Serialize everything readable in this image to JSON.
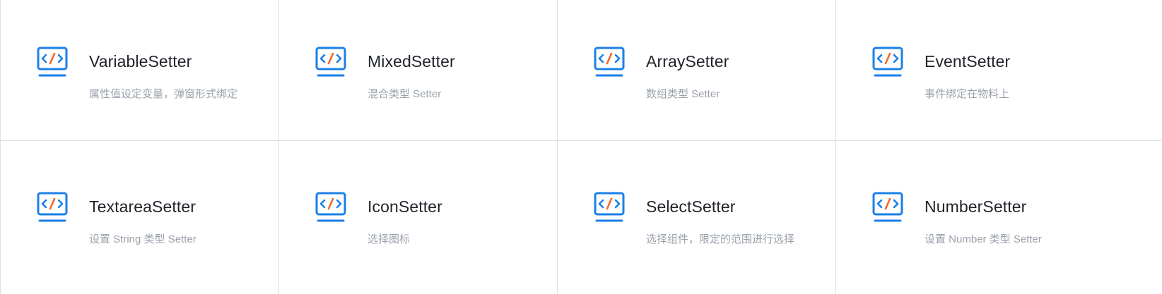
{
  "colors": {
    "icon_blue": "#1b7fe8",
    "icon_orange": "#f26a2b",
    "title": "#1f2329",
    "description": "#9aa1ab",
    "divider": "#dcdfe6"
  },
  "cards": [
    {
      "icon": "code-monitor-icon",
      "title": "VariableSetter",
      "description": "属性值设定变量，弹窗形式绑定"
    },
    {
      "icon": "code-monitor-icon",
      "title": "MixedSetter",
      "description": "混合类型 Setter"
    },
    {
      "icon": "code-monitor-icon",
      "title": "ArraySetter",
      "description": "数组类型 Setter"
    },
    {
      "icon": "code-monitor-icon",
      "title": "EventSetter",
      "description": "事件绑定在物料上"
    },
    {
      "icon": "code-monitor-icon",
      "title": "TextareaSetter",
      "description": "设置 String 类型 Setter"
    },
    {
      "icon": "code-monitor-icon",
      "title": "IconSetter",
      "description": "选择图标"
    },
    {
      "icon": "code-monitor-icon",
      "title": "SelectSetter",
      "description": "选择组件，限定的范围进行选择"
    },
    {
      "icon": "code-monitor-icon",
      "title": "NumberSetter",
      "description": "设置 Number 类型 Setter"
    }
  ]
}
